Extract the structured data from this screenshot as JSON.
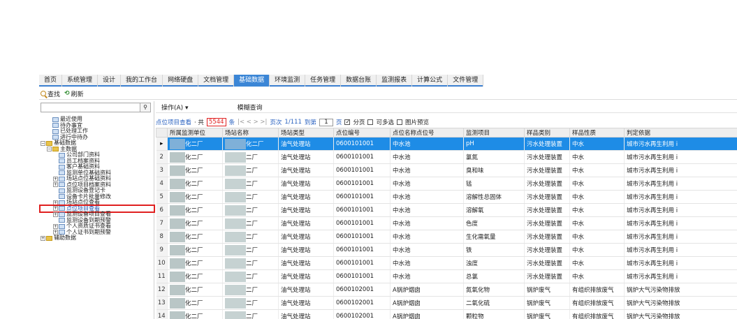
{
  "menu": {
    "tabs": [
      {
        "label": "首页",
        "active": false
      },
      {
        "label": "系统管理",
        "active": false
      },
      {
        "label": "设计",
        "active": false
      },
      {
        "label": "我的工作台",
        "active": false
      },
      {
        "label": "网络硬盘",
        "active": false
      },
      {
        "label": "文档管理",
        "active": false
      },
      {
        "label": "基础数据",
        "active": true
      },
      {
        "label": "环境监测",
        "active": false
      },
      {
        "label": "任务管理",
        "active": false
      },
      {
        "label": "数据台账",
        "active": false
      },
      {
        "label": "监测报表",
        "active": false
      },
      {
        "label": "计算公式",
        "active": false
      },
      {
        "label": "文件管理",
        "active": false
      }
    ]
  },
  "toolbar": {
    "search_label": "查找",
    "refresh_label": "刷新"
  },
  "left": {
    "search_placeholder": "",
    "tree": [
      {
        "label": "最近使用",
        "indent": 1,
        "icon": "doc",
        "exp": ""
      },
      {
        "label": "待办事宜",
        "indent": 1,
        "icon": "doc",
        "exp": ""
      },
      {
        "label": "已处理工作",
        "indent": 1,
        "icon": "doc",
        "exp": ""
      },
      {
        "label": "进行中待办",
        "indent": 1,
        "icon": "doc",
        "exp": ""
      },
      {
        "label": "基础数据",
        "indent": 0,
        "icon": "fold",
        "exp": "−"
      },
      {
        "label": "主数据",
        "indent": 1,
        "icon": "fold",
        "exp": "−"
      },
      {
        "label": "公司部门资料",
        "indent": 2,
        "icon": "doc",
        "exp": ""
      },
      {
        "label": "员工档案资料",
        "indent": 2,
        "icon": "doc",
        "exp": ""
      },
      {
        "label": "客户基础资料",
        "indent": 2,
        "icon": "doc",
        "exp": ""
      },
      {
        "label": "监测单位基础资料",
        "indent": 2,
        "icon": "doc",
        "exp": ""
      },
      {
        "label": "场站点位基础资料",
        "indent": 2,
        "icon": "doc",
        "exp": "+"
      },
      {
        "label": "点位项目档案资料",
        "indent": 2,
        "icon": "doc",
        "exp": "+"
      },
      {
        "label": "监测设备登记卡",
        "indent": 2,
        "icon": "doc",
        "exp": ""
      },
      {
        "label": "设备卡片批量修改",
        "indent": 2,
        "icon": "doc",
        "exp": ""
      },
      {
        "label": "场站点位查看",
        "indent": 2,
        "icon": "doc",
        "exp": "+"
      },
      {
        "label": "点位项目查看",
        "indent": 2,
        "icon": "doc",
        "exp": "+",
        "selected": true
      },
      {
        "label": "监测设备项目查看",
        "indent": 2,
        "icon": "doc",
        "exp": "+"
      },
      {
        "label": "监测设备到期预警",
        "indent": 2,
        "icon": "doc",
        "exp": ""
      },
      {
        "label": "个人资质证书查看",
        "indent": 2,
        "icon": "doc",
        "exp": "+"
      },
      {
        "label": "个人证书到期预警",
        "indent": 2,
        "icon": "doc",
        "exp": "+"
      },
      {
        "label": "辅助数据",
        "indent": 0,
        "icon": "fold",
        "exp": "+"
      }
    ]
  },
  "opbar": {
    "operate_label": "操作(A) ▾",
    "fuzzy_label": "模糊查询"
  },
  "pager": {
    "title": "点位项目查看",
    "total_prefix": "· 共",
    "total": "5544",
    "total_suffix": "条",
    "nav": "|< < > >|",
    "page_label": "页次",
    "page_info": "1/111",
    "goto_label": "到第",
    "page_input": "1",
    "page_suffix": "页",
    "paging_label": "分页",
    "multi_label": "可多选",
    "preview_label": "图片预览"
  },
  "grid": {
    "columns": [
      "",
      "所属监测单位",
      "场站名称",
      "场站类型",
      "点位编号",
      "点位名称点位号",
      "监测项目",
      "样品类别",
      "样品性质",
      "判定依据"
    ],
    "rows": [
      {
        "n": "▸",
        "unit": "化二厂",
        "station": "化二厂",
        "type": "油气处理站",
        "code": "0600101001",
        "point": "中水池",
        "item": "pH",
        "cat": "污水处理装置",
        "nature": "中水",
        "basis": "城市污水再生利用 i"
      },
      {
        "n": "2",
        "unit": "化二厂",
        "station": "二厂",
        "type": "油气处理站",
        "code": "0600101001",
        "point": "中水池",
        "item": "氯氮",
        "cat": "污水处理装置",
        "nature": "中水",
        "basis": "城市污水再生利用 i"
      },
      {
        "n": "3",
        "unit": "化二厂",
        "station": "二厂",
        "type": "油气处理站",
        "code": "0600101001",
        "point": "中水池",
        "item": "臭和味",
        "cat": "污水处理装置",
        "nature": "中水",
        "basis": "城市污水再生利用 i"
      },
      {
        "n": "4",
        "unit": "化二厂",
        "station": "二厂",
        "type": "油气处理站",
        "code": "0600101001",
        "point": "中水池",
        "item": "锰",
        "cat": "污水处理装置",
        "nature": "中水",
        "basis": "城市污水再生利用 i"
      },
      {
        "n": "5",
        "unit": "化二厂",
        "station": "二厂",
        "type": "油气处理站",
        "code": "0600101001",
        "point": "中水池",
        "item": "溶解性总固体",
        "cat": "污水处理装置",
        "nature": "中水",
        "basis": "城市污水再生利用 i"
      },
      {
        "n": "6",
        "unit": "化二厂",
        "station": "二厂",
        "type": "油气处理站",
        "code": "0600101001",
        "point": "中水池",
        "item": "溶解氧",
        "cat": "污水处理装置",
        "nature": "中水",
        "basis": "城市污水再生利用 i"
      },
      {
        "n": "7",
        "unit": "化二厂",
        "station": "二厂",
        "type": "油气处理站",
        "code": "0600101001",
        "point": "中水池",
        "item": "色度",
        "cat": "污水处理装置",
        "nature": "中水",
        "basis": "城市污水再生利用 i"
      },
      {
        "n": "8",
        "unit": "化二厂",
        "station": "二厂",
        "type": "油气处理站",
        "code": "0600101001",
        "point": "中水池",
        "item": "生化需氧量",
        "cat": "污水处理装置",
        "nature": "中水",
        "basis": "城市污水再生利用 i"
      },
      {
        "n": "9",
        "unit": "化二厂",
        "station": "二厂",
        "type": "油气处理站",
        "code": "0600101001",
        "point": "中水池",
        "item": "铁",
        "cat": "污水处理装置",
        "nature": "中水",
        "basis": "城市污水再生利用 i"
      },
      {
        "n": "10",
        "unit": "化二厂",
        "station": "二厂",
        "type": "油气处理站",
        "code": "0600101001",
        "point": "中水池",
        "item": "浊度",
        "cat": "污水处理装置",
        "nature": "中水",
        "basis": "城市污水再生利用 i"
      },
      {
        "n": "11",
        "unit": "化二厂",
        "station": "二厂",
        "type": "油气处理站",
        "code": "0600101001",
        "point": "中水池",
        "item": "总氯",
        "cat": "污水处理装置",
        "nature": "中水",
        "basis": "城市污水再生利用 i"
      },
      {
        "n": "12",
        "unit": "化二厂",
        "station": "二厂",
        "type": "油气处理站",
        "code": "0600102001",
        "point": "A锅炉烟囱",
        "item": "氮氧化物",
        "cat": "锅炉废气",
        "nature": "有组织排放废气",
        "basis": "锅炉大气污染物排放"
      },
      {
        "n": "13",
        "unit": "化二厂",
        "station": "二厂",
        "type": "油气处理站",
        "code": "0600102001",
        "point": "A锅炉烟囱",
        "item": "二氧化硫",
        "cat": "锅炉废气",
        "nature": "有组织排放废气",
        "basis": "锅炉大气污染物排放"
      },
      {
        "n": "14",
        "unit": "化二厂",
        "station": "二厂",
        "type": "油气处理站",
        "code": "0600102001",
        "point": "A锅炉烟囱",
        "item": "颗粒物",
        "cat": "锅炉废气",
        "nature": "有组织排放废气",
        "basis": "锅炉大气污染物排放"
      }
    ]
  }
}
